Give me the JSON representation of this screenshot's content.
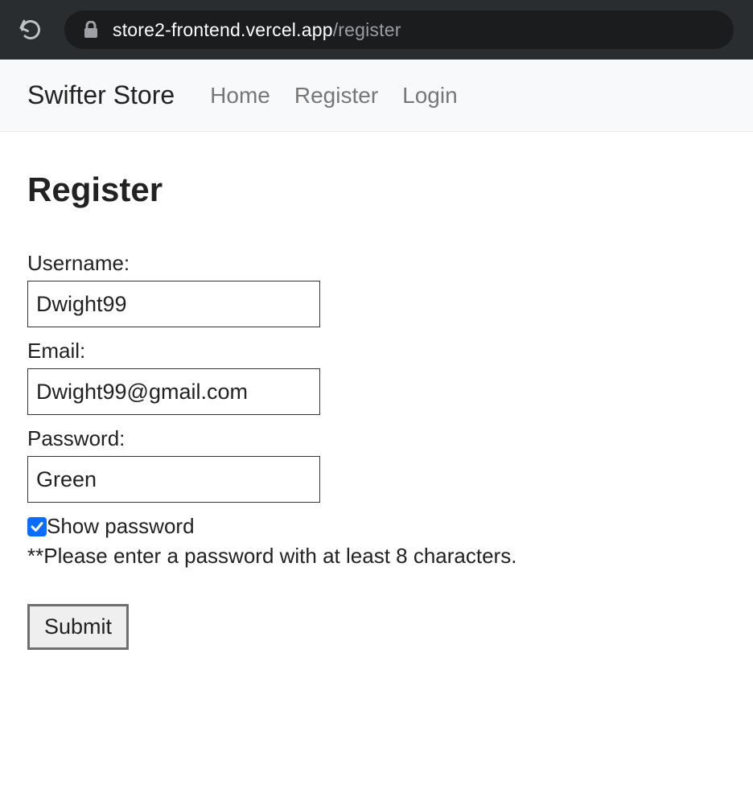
{
  "browser": {
    "url_host": "store2-frontend.vercel.app",
    "url_path": "/register"
  },
  "header": {
    "brand": "Swifter Store",
    "nav": {
      "home": "Home",
      "register": "Register",
      "login": "Login"
    }
  },
  "page": {
    "title": "Register"
  },
  "form": {
    "username": {
      "label": "Username:",
      "value": "Dwight99"
    },
    "email": {
      "label": "Email:",
      "value": "Dwight99@gmail.com"
    },
    "password": {
      "label": "Password:",
      "value": "Green"
    },
    "show_password": {
      "label": "Show password",
      "checked": true
    },
    "hint": "**Please enter a password with at least 8 characters.",
    "submit_label": "Submit"
  }
}
